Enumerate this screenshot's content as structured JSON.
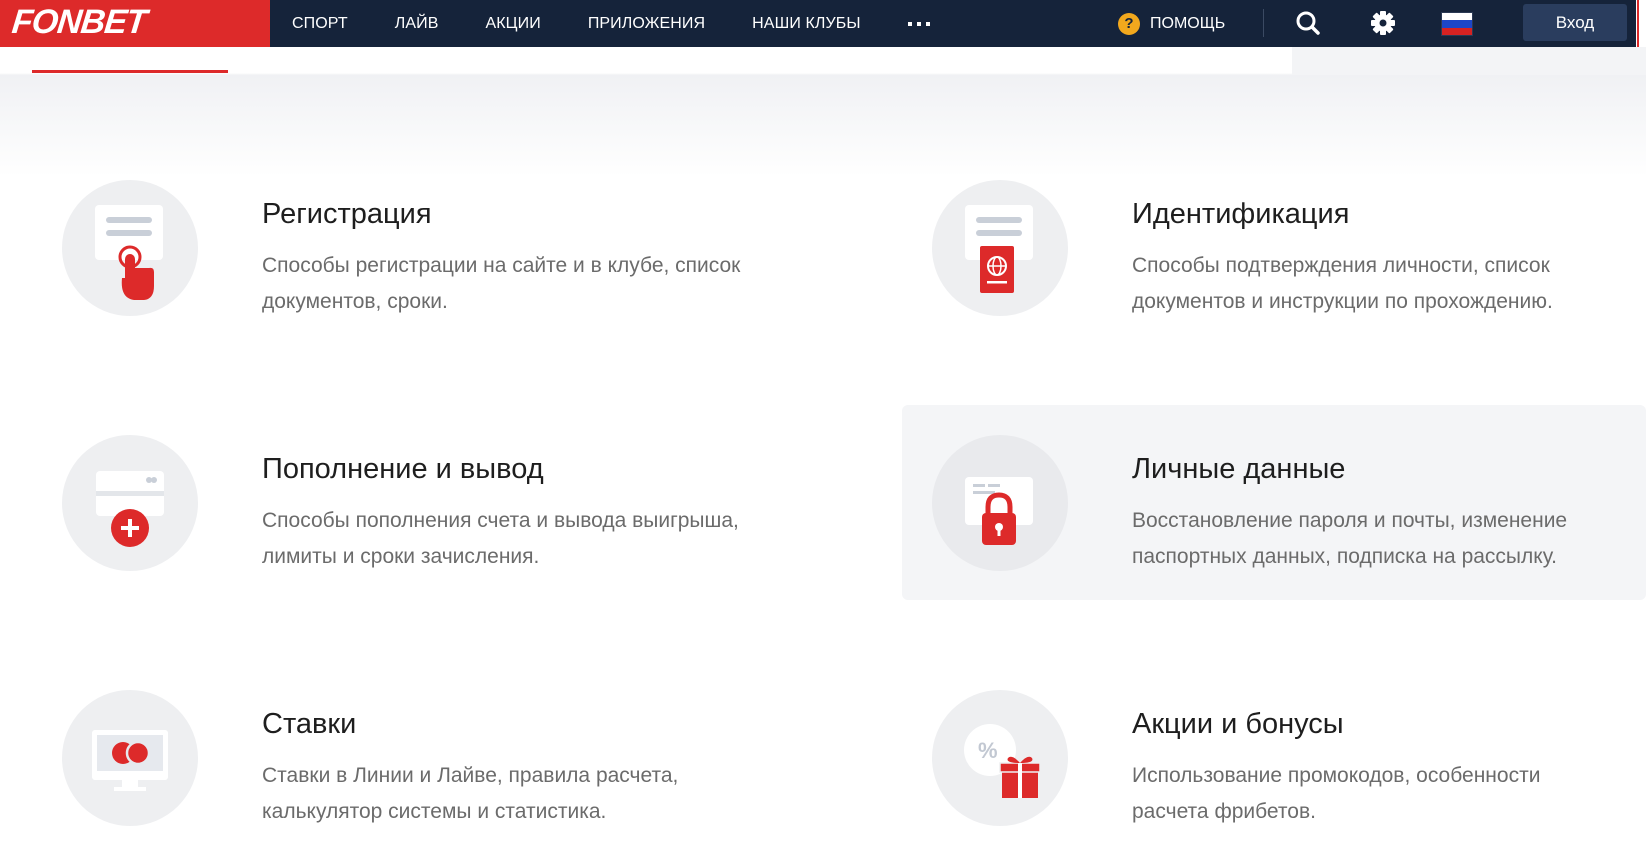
{
  "header": {
    "logo": "FONBET",
    "nav": [
      "СПОРТ",
      "ЛАЙВ",
      "АКЦИИ",
      "ПРИЛОЖЕНИЯ",
      "НАШИ КЛУБЫ"
    ],
    "help_badge": "?",
    "help_label": "ПОМОЩЬ",
    "login_label": "Вход",
    "icons": [
      "more-icon",
      "help-icon",
      "search-icon",
      "gear-icon",
      "russia-flag-icon"
    ]
  },
  "colors": {
    "brand_red": "#dd2a2a",
    "header_bg": "#15233a",
    "help_badge": "#f2a81d",
    "card_icon_bg": "#eeeff1"
  },
  "cards": [
    {
      "title": "Регистрация",
      "description": "Способы регистрации на сайте и в клубе, список документов, сроки.",
      "icon": "registration-hand-icon"
    },
    {
      "title": "Идентификация",
      "description": "Способы подтверждения личности, список документов и инструкции по прохождению.",
      "icon": "passport-icon"
    },
    {
      "title": "Пополнение и вывод",
      "description": "Способы пополнения счета и вывода выигрыша, лимиты и сроки зачисления.",
      "icon": "card-plus-icon"
    },
    {
      "title": "Личные данные",
      "description": "Восстановление пароля и почты, изменение паспортных данных, подписка на рассылку.",
      "icon": "lock-icon"
    },
    {
      "title": "Ставки",
      "description": "Ставки в Линии и Лайве, правила расчета, калькулятор системы и статистика.",
      "icon": "monitor-icon"
    },
    {
      "title": "Акции и бонусы",
      "description": "Использование промокодов, особенности расчета фрибетов.",
      "icon": "gift-percent-icon",
      "icon_text": "%"
    }
  ]
}
